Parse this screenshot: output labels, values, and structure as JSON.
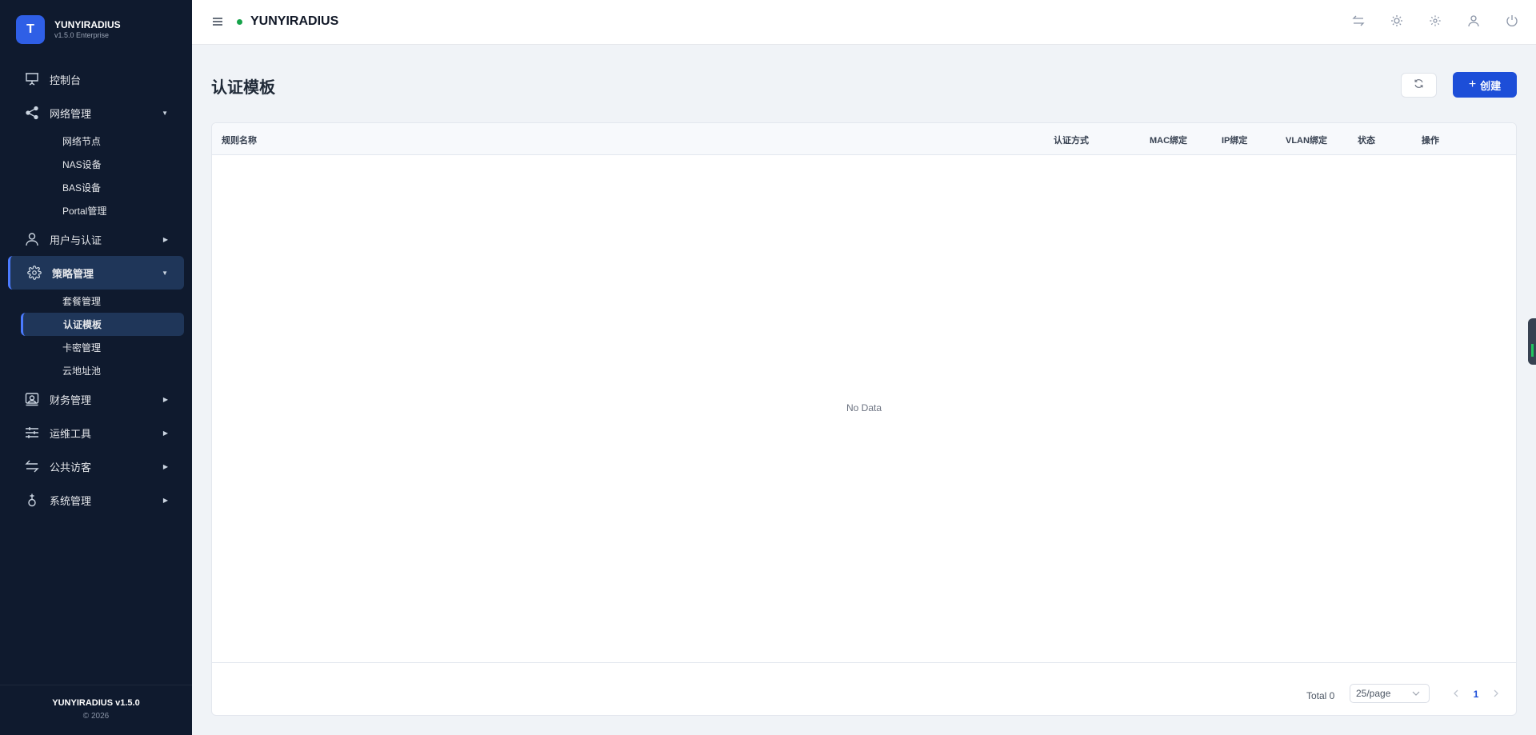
{
  "brand": {
    "logo_letter": "T",
    "name": "YUNYIRADIUS",
    "subtitle": "v1.5.0 Enterprise"
  },
  "sidebar": {
    "items": [
      {
        "label": "控制台",
        "icon": "presentation-board-icon"
      },
      {
        "label": "网络管理",
        "icon": "share-network-icon",
        "children": [
          "网络节点",
          "NAS设备",
          "BAS设备",
          "Portal管理"
        ]
      },
      {
        "label": "用户与认证",
        "icon": "user-icon"
      },
      {
        "label": "策略管理",
        "icon": "gear-icon",
        "active": true,
        "children": [
          "套餐管理",
          "认证模板",
          "卡密管理",
          "云地址池"
        ],
        "active_child": "认证模板"
      },
      {
        "label": "财务管理",
        "icon": "finance-icon"
      },
      {
        "label": "运维工具",
        "icon": "sliders-icon"
      },
      {
        "label": "公共访客",
        "icon": "swap-arrows-icon"
      },
      {
        "label": "系统管理",
        "icon": "system-icon"
      }
    ],
    "footer": {
      "version": "YUNYIRADIUS v1.5.0",
      "copyright": "© 2026"
    }
  },
  "header": {
    "title": "YUNYIRADIUS",
    "status_color": "#16a34a",
    "icons": [
      "swap-icon",
      "sun-icon",
      "settings-icon",
      "user-icon",
      "power-icon"
    ]
  },
  "page": {
    "title": "认证模板",
    "create_label": "创建",
    "accent": "#1d4ed8"
  },
  "table": {
    "columns": [
      "规则名称",
      "认证方式",
      "MAC绑定",
      "IP绑定",
      "VLAN绑定",
      "状态",
      "操作"
    ],
    "rows": [],
    "empty_text": "No Data"
  },
  "pagination": {
    "total_label": "Total 0",
    "page_size": "25/page",
    "current_page": "1"
  }
}
